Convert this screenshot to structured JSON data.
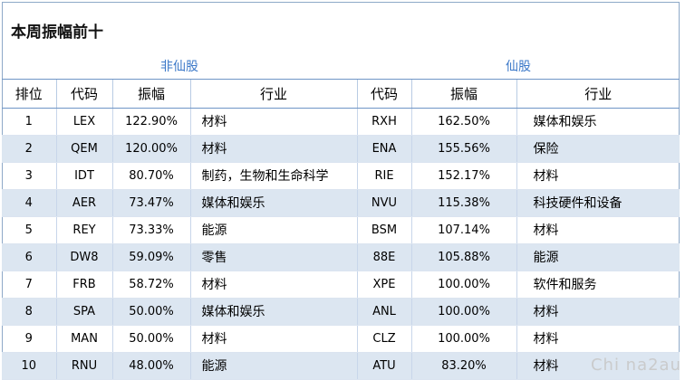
{
  "title": "本周振幅前十",
  "groups": {
    "left": "非仙股",
    "right": "仙股"
  },
  "headers": [
    "排位",
    "代码",
    "振幅",
    "行业",
    "代码",
    "振幅",
    "行业"
  ],
  "rows": [
    {
      "rank": "1",
      "code_a": "LEX",
      "amp_a": "122.90%",
      "ind_a": "材料",
      "code_b": "RXH",
      "amp_b": "162.50%",
      "ind_b": "媒体和娱乐"
    },
    {
      "rank": "2",
      "code_a": "QEM",
      "amp_a": "120.00%",
      "ind_a": "材料",
      "code_b": "ENA",
      "amp_b": "155.56%",
      "ind_b": "保险"
    },
    {
      "rank": "3",
      "code_a": "IDT",
      "amp_a": "80.70%",
      "ind_a": "制药，生物和生命科学",
      "code_b": "RIE",
      "amp_b": "152.17%",
      "ind_b": "材料"
    },
    {
      "rank": "4",
      "code_a": "AER",
      "amp_a": "73.47%",
      "ind_a": "媒体和娱乐",
      "code_b": "NVU",
      "amp_b": "115.38%",
      "ind_b": "科技硬件和设备"
    },
    {
      "rank": "5",
      "code_a": "REY",
      "amp_a": "73.33%",
      "ind_a": "能源",
      "code_b": "BSM",
      "amp_b": "107.14%",
      "ind_b": "材料"
    },
    {
      "rank": "6",
      "code_a": "DW8",
      "amp_a": "59.09%",
      "ind_a": "零售",
      "code_b": "88E",
      "amp_b": "105.88%",
      "ind_b": "能源"
    },
    {
      "rank": "7",
      "code_a": "FRB",
      "amp_a": "58.72%",
      "ind_a": "材料",
      "code_b": "XPE",
      "amp_b": "100.00%",
      "ind_b": "软件和服务"
    },
    {
      "rank": "8",
      "code_a": "SPA",
      "amp_a": "50.00%",
      "ind_a": "媒体和娱乐",
      "code_b": "ANL",
      "amp_b": "100.00%",
      "ind_b": "材料"
    },
    {
      "rank": "9",
      "code_a": "MAN",
      "amp_a": "50.00%",
      "ind_a": "材料",
      "code_b": "CLZ",
      "amp_b": "100.00%",
      "ind_b": "材料"
    },
    {
      "rank": "10",
      "code_a": "RNU",
      "amp_a": "48.00%",
      "ind_a": "能源",
      "code_b": "ATU",
      "amp_b": "83.20%",
      "ind_b": "材料"
    }
  ],
  "watermark": "Chi na2au",
  "colors": {
    "group_text": "#3b78c8",
    "alt_row": "#dce6f1",
    "border": "#6f95c6"
  }
}
